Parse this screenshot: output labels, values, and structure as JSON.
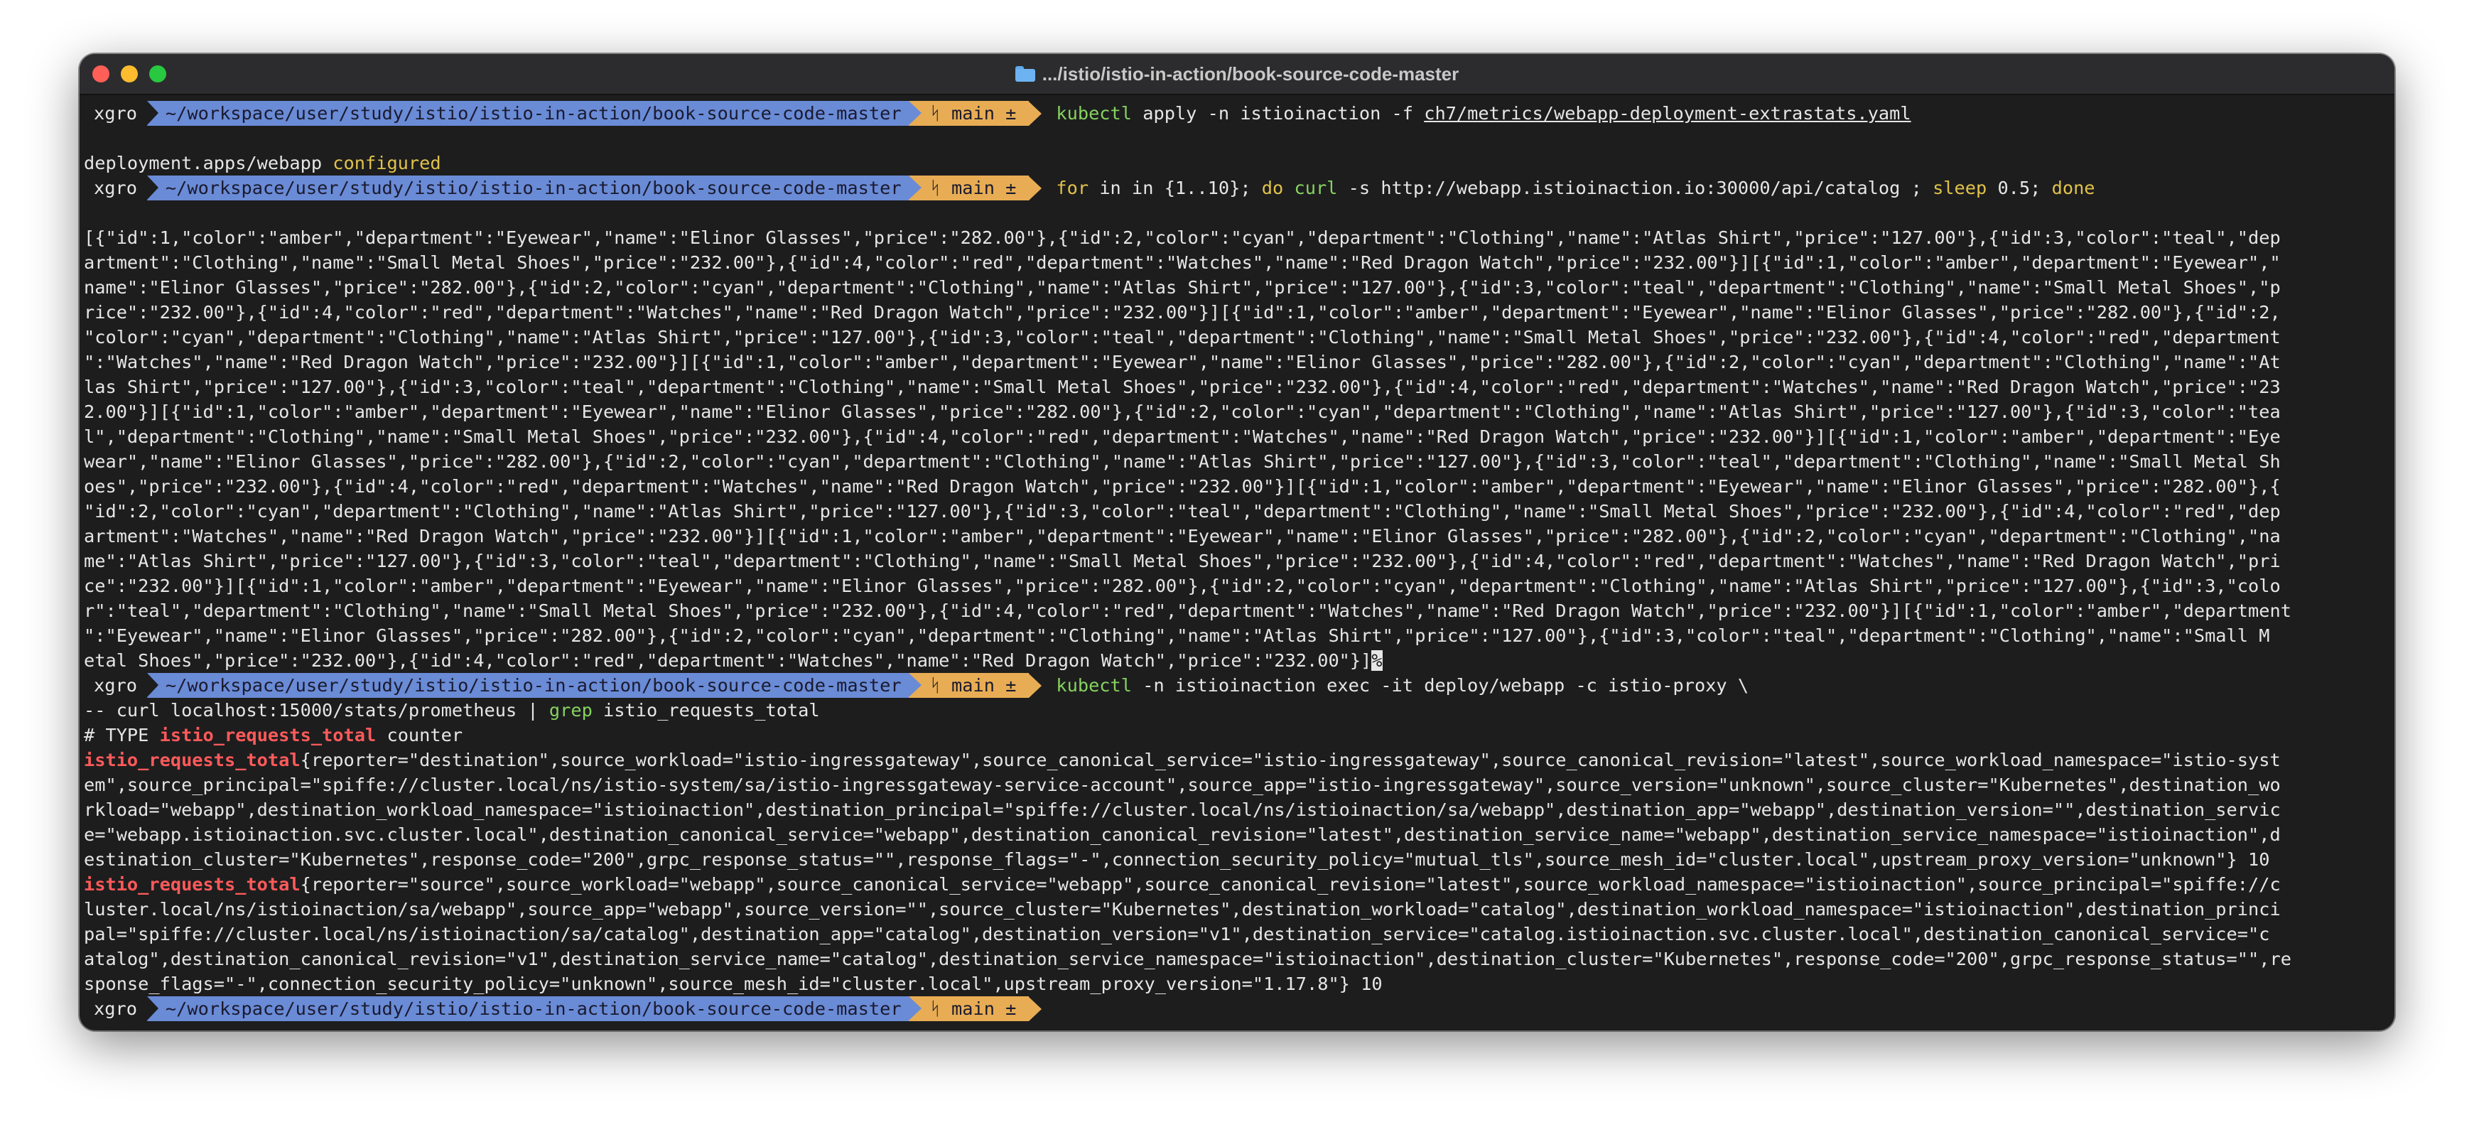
{
  "window": {
    "title": ".../istio/istio-in-action/book-source-code-master"
  },
  "prompt": {
    "user": "xgro",
    "path": "~/workspace/user/study/istio/istio-in-action/book-source-code-master",
    "branch_icon": "ᛋ",
    "branch": "main ±"
  },
  "session": {
    "cmd1": {
      "bin": "kubectl",
      "args": " apply -n istioinaction -f ",
      "file": "ch7/metrics/webapp-deployment-extrastats.yaml"
    },
    "out1": {
      "text": "deployment.apps/webapp ",
      "status": "configured"
    },
    "cmd2": {
      "kw_for": "for",
      "p1": " in in {1..10}; ",
      "kw_do": "do",
      "p2": " ",
      "bin": "curl",
      "p3": " -s http://webapp.istioinaction.io:30000/api/catalog ; ",
      "kw_sleep": "sleep",
      "p4": " 0.5; ",
      "kw_done": "done"
    },
    "json_lines": [
      "[{\"id\":1,\"color\":\"amber\",\"department\":\"Eyewear\",\"name\":\"Elinor Glasses\",\"price\":\"282.00\"},{\"id\":2,\"color\":\"cyan\",\"department\":\"Clothing\",\"name\":\"Atlas Shirt\",\"price\":\"127.00\"},{\"id\":3,\"color\":\"teal\",\"dep",
      "artment\":\"Clothing\",\"name\":\"Small Metal Shoes\",\"price\":\"232.00\"},{\"id\":4,\"color\":\"red\",\"department\":\"Watches\",\"name\":\"Red Dragon Watch\",\"price\":\"232.00\"}][{\"id\":1,\"color\":\"amber\",\"department\":\"Eyewear\",\"",
      "name\":\"Elinor Glasses\",\"price\":\"282.00\"},{\"id\":2,\"color\":\"cyan\",\"department\":\"Clothing\",\"name\":\"Atlas Shirt\",\"price\":\"127.00\"},{\"id\":3,\"color\":\"teal\",\"department\":\"Clothing\",\"name\":\"Small Metal Shoes\",\"p",
      "rice\":\"232.00\"},{\"id\":4,\"color\":\"red\",\"department\":\"Watches\",\"name\":\"Red Dragon Watch\",\"price\":\"232.00\"}][{\"id\":1,\"color\":\"amber\",\"department\":\"Eyewear\",\"name\":\"Elinor Glasses\",\"price\":\"282.00\"},{\"id\":2,",
      "\"color\":\"cyan\",\"department\":\"Clothing\",\"name\":\"Atlas Shirt\",\"price\":\"127.00\"},{\"id\":3,\"color\":\"teal\",\"department\":\"Clothing\",\"name\":\"Small Metal Shoes\",\"price\":\"232.00\"},{\"id\":4,\"color\":\"red\",\"department",
      "\":\"Watches\",\"name\":\"Red Dragon Watch\",\"price\":\"232.00\"}][{\"id\":1,\"color\":\"amber\",\"department\":\"Eyewear\",\"name\":\"Elinor Glasses\",\"price\":\"282.00\"},{\"id\":2,\"color\":\"cyan\",\"department\":\"Clothing\",\"name\":\"At",
      "las Shirt\",\"price\":\"127.00\"},{\"id\":3,\"color\":\"teal\",\"department\":\"Clothing\",\"name\":\"Small Metal Shoes\",\"price\":\"232.00\"},{\"id\":4,\"color\":\"red\",\"department\":\"Watches\",\"name\":\"Red Dragon Watch\",\"price\":\"23",
      "2.00\"}][{\"id\":1,\"color\":\"amber\",\"department\":\"Eyewear\",\"name\":\"Elinor Glasses\",\"price\":\"282.00\"},{\"id\":2,\"color\":\"cyan\",\"department\":\"Clothing\",\"name\":\"Atlas Shirt\",\"price\":\"127.00\"},{\"id\":3,\"color\":\"tea",
      "l\",\"department\":\"Clothing\",\"name\":\"Small Metal Shoes\",\"price\":\"232.00\"},{\"id\":4,\"color\":\"red\",\"department\":\"Watches\",\"name\":\"Red Dragon Watch\",\"price\":\"232.00\"}][{\"id\":1,\"color\":\"amber\",\"department\":\"Eye",
      "wear\",\"name\":\"Elinor Glasses\",\"price\":\"282.00\"},{\"id\":2,\"color\":\"cyan\",\"department\":\"Clothing\",\"name\":\"Atlas Shirt\",\"price\":\"127.00\"},{\"id\":3,\"color\":\"teal\",\"department\":\"Clothing\",\"name\":\"Small Metal Sh",
      "oes\",\"price\":\"232.00\"},{\"id\":4,\"color\":\"red\",\"department\":\"Watches\",\"name\":\"Red Dragon Watch\",\"price\":\"232.00\"}][{\"id\":1,\"color\":\"amber\",\"department\":\"Eyewear\",\"name\":\"Elinor Glasses\",\"price\":\"282.00\"},{",
      "\"id\":2,\"color\":\"cyan\",\"department\":\"Clothing\",\"name\":\"Atlas Shirt\",\"price\":\"127.00\"},{\"id\":3,\"color\":\"teal\",\"department\":\"Clothing\",\"name\":\"Small Metal Shoes\",\"price\":\"232.00\"},{\"id\":4,\"color\":\"red\",\"dep",
      "artment\":\"Watches\",\"name\":\"Red Dragon Watch\",\"price\":\"232.00\"}][{\"id\":1,\"color\":\"amber\",\"department\":\"Eyewear\",\"name\":\"Elinor Glasses\",\"price\":\"282.00\"},{\"id\":2,\"color\":\"cyan\",\"department\":\"Clothing\",\"na",
      "me\":\"Atlas Shirt\",\"price\":\"127.00\"},{\"id\":3,\"color\":\"teal\",\"department\":\"Clothing\",\"name\":\"Small Metal Shoes\",\"price\":\"232.00\"},{\"id\":4,\"color\":\"red\",\"department\":\"Watches\",\"name\":\"Red Dragon Watch\",\"pri",
      "ce\":\"232.00\"}][{\"id\":1,\"color\":\"amber\",\"department\":\"Eyewear\",\"name\":\"Elinor Glasses\",\"price\":\"282.00\"},{\"id\":2,\"color\":\"cyan\",\"department\":\"Clothing\",\"name\":\"Atlas Shirt\",\"price\":\"127.00\"},{\"id\":3,\"colo",
      "r\":\"teal\",\"department\":\"Clothing\",\"name\":\"Small Metal Shoes\",\"price\":\"232.00\"},{\"id\":4,\"color\":\"red\",\"department\":\"Watches\",\"name\":\"Red Dragon Watch\",\"price\":\"232.00\"}][{\"id\":1,\"color\":\"amber\",\"department",
      "\":\"Eyewear\",\"name\":\"Elinor Glasses\",\"price\":\"282.00\"},{\"id\":2,\"color\":\"cyan\",\"department\":\"Clothing\",\"name\":\"Atlas Shirt\",\"price\":\"127.00\"},{\"id\":3,\"color\":\"teal\",\"department\":\"Clothing\",\"name\":\"Small M"
    ],
    "json_last": "etal Shoes\",\"price\":\"232.00\"},{\"id\":4,\"color\":\"red\",\"department\":\"Watches\",\"name\":\"Red Dragon Watch\",\"price\":\"232.00\"}]",
    "json_cursor": "%",
    "cmd3": {
      "bin": "kubectl",
      "args": " -n istioinaction exec -it deploy/webapp -c istio-proxy \\"
    },
    "cmd3b": {
      "p1": "-- curl localhost:15000/stats/prometheus | ",
      "grep": "grep",
      "p2": " istio_requests_total"
    },
    "type_line": {
      "p1": "# TYPE ",
      "metric": "istio_requests_total",
      "p2": " counter"
    },
    "metric1": {
      "name": "istio_requests_total",
      "l1": "{reporter=\"destination\",source_workload=\"istio-ingressgateway\",source_canonical_service=\"istio-ingressgateway\",source_canonical_revision=\"latest\",source_workload_namespace=\"istio-syst",
      "rest": [
        "em\",source_principal=\"spiffe://cluster.local/ns/istio-system/sa/istio-ingressgateway-service-account\",source_app=\"istio-ingressgateway\",source_version=\"unknown\",source_cluster=\"Kubernetes\",destination_wo",
        "rkload=\"webapp\",destination_workload_namespace=\"istioinaction\",destination_principal=\"spiffe://cluster.local/ns/istioinaction/sa/webapp\",destination_app=\"webapp\",destination_version=\"\",destination_servic",
        "e=\"webapp.istioinaction.svc.cluster.local\",destination_canonical_service=\"webapp\",destination_canonical_revision=\"latest\",destination_service_name=\"webapp\",destination_service_namespace=\"istioinaction\",d",
        "estination_cluster=\"Kubernetes\",response_code=\"200\",grpc_response_status=\"\",response_flags=\"-\",connection_security_policy=\"mutual_tls\",source_mesh_id=\"cluster.local\",upstream_proxy_version=\"unknown\"} 10"
      ]
    },
    "metric2": {
      "name": "istio_requests_total",
      "l1": "{reporter=\"source\",source_workload=\"webapp\",source_canonical_service=\"webapp\",source_canonical_revision=\"latest\",source_workload_namespace=\"istioinaction\",source_principal=\"spiffe://c",
      "rest": [
        "luster.local/ns/istioinaction/sa/webapp\",source_app=\"webapp\",source_version=\"\",source_cluster=\"Kubernetes\",destination_workload=\"catalog\",destination_workload_namespace=\"istioinaction\",destination_princi",
        "pal=\"spiffe://cluster.local/ns/istioinaction/sa/catalog\",destination_app=\"catalog\",destination_version=\"v1\",destination_service=\"catalog.istioinaction.svc.cluster.local\",destination_canonical_service=\"c",
        "atalog\",destination_canonical_revision=\"v1\",destination_service_name=\"catalog\",destination_service_namespace=\"istioinaction\",destination_cluster=\"Kubernetes\",response_code=\"200\",grpc_response_status=\"\",re",
        "sponse_flags=\"-\",connection_security_policy=\"unknown\",source_mesh_id=\"cluster.local\",upstream_proxy_version=\"1.17.8\"} 10"
      ]
    }
  },
  "colors": {
    "terminal_bg": "#1d1d1e",
    "path_segment": "#6a8bd6",
    "git_segment": "#e8ad54",
    "command": "#86d25f",
    "metric_name": "#ff5a5a",
    "status_configured": "#e0c24a"
  }
}
